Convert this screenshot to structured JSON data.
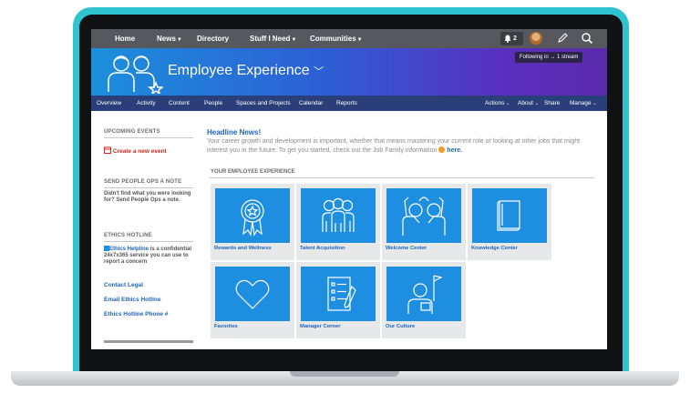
{
  "topnav": {
    "items": [
      {
        "label": "Home"
      },
      {
        "label": "News"
      },
      {
        "label": "Directory"
      },
      {
        "label": "Stuff I Need"
      },
      {
        "label": "Communities"
      }
    ],
    "notification_count": "2"
  },
  "banner": {
    "title": "Employee Experience",
    "following": "Following in → 1 stream"
  },
  "subnav": {
    "left": [
      "Overview",
      "Activity",
      "Content",
      "People",
      "Spaces and Projects",
      "Calendar",
      "Reports"
    ],
    "right": [
      "Actions",
      "About",
      "Share",
      "Manage"
    ]
  },
  "sidebar": {
    "upcoming_events": {
      "heading": "UPCOMING EVENTS",
      "create_link": "Create a new event"
    },
    "send_note": {
      "heading": "SEND PEOPLE OPS A NOTE",
      "text": "Didn't find what you were looking for? Send People Ops a note."
    },
    "ethics": {
      "heading": "ETHICS HOTLINE",
      "helpline_label": "Ethics Helpline",
      "helpline_text": " is a confidential 24x7x365 service you can use to report a concern",
      "links": [
        "Contact Legal",
        "Email Ethics Hotline",
        "Ethics Hotline Phone #"
      ]
    }
  },
  "main": {
    "headline": "Headline News!",
    "intro": "Your career growth and development is important, whether that means mastering your current role or looking at other jobs that might interest you in the future. To get you started, check out the Job Family information ",
    "intro_link": "here.",
    "section_title": "YOUR EMPLOYEE EXPERIENCE",
    "tiles": [
      {
        "label": "Rewards and Wellness",
        "icon": "award-ribbon-icon"
      },
      {
        "label": "Talent Acquisition",
        "icon": "team-group-icon"
      },
      {
        "label": "Welcome Center",
        "icon": "high-five-icon"
      },
      {
        "label": "Knowledge Center",
        "icon": "book-icon"
      },
      {
        "label": "Favorites",
        "icon": "heart-icon"
      },
      {
        "label": "Manager Corner",
        "icon": "checklist-icon"
      },
      {
        "label": "Our Culture",
        "icon": "person-flag-icon"
      }
    ]
  },
  "colors": {
    "frame": "#2fc2cf",
    "topnav": "#56585d",
    "subnav": "#2a3f7a",
    "tile_blue": "#1e8ee0",
    "link_blue": "#1d63b8"
  }
}
